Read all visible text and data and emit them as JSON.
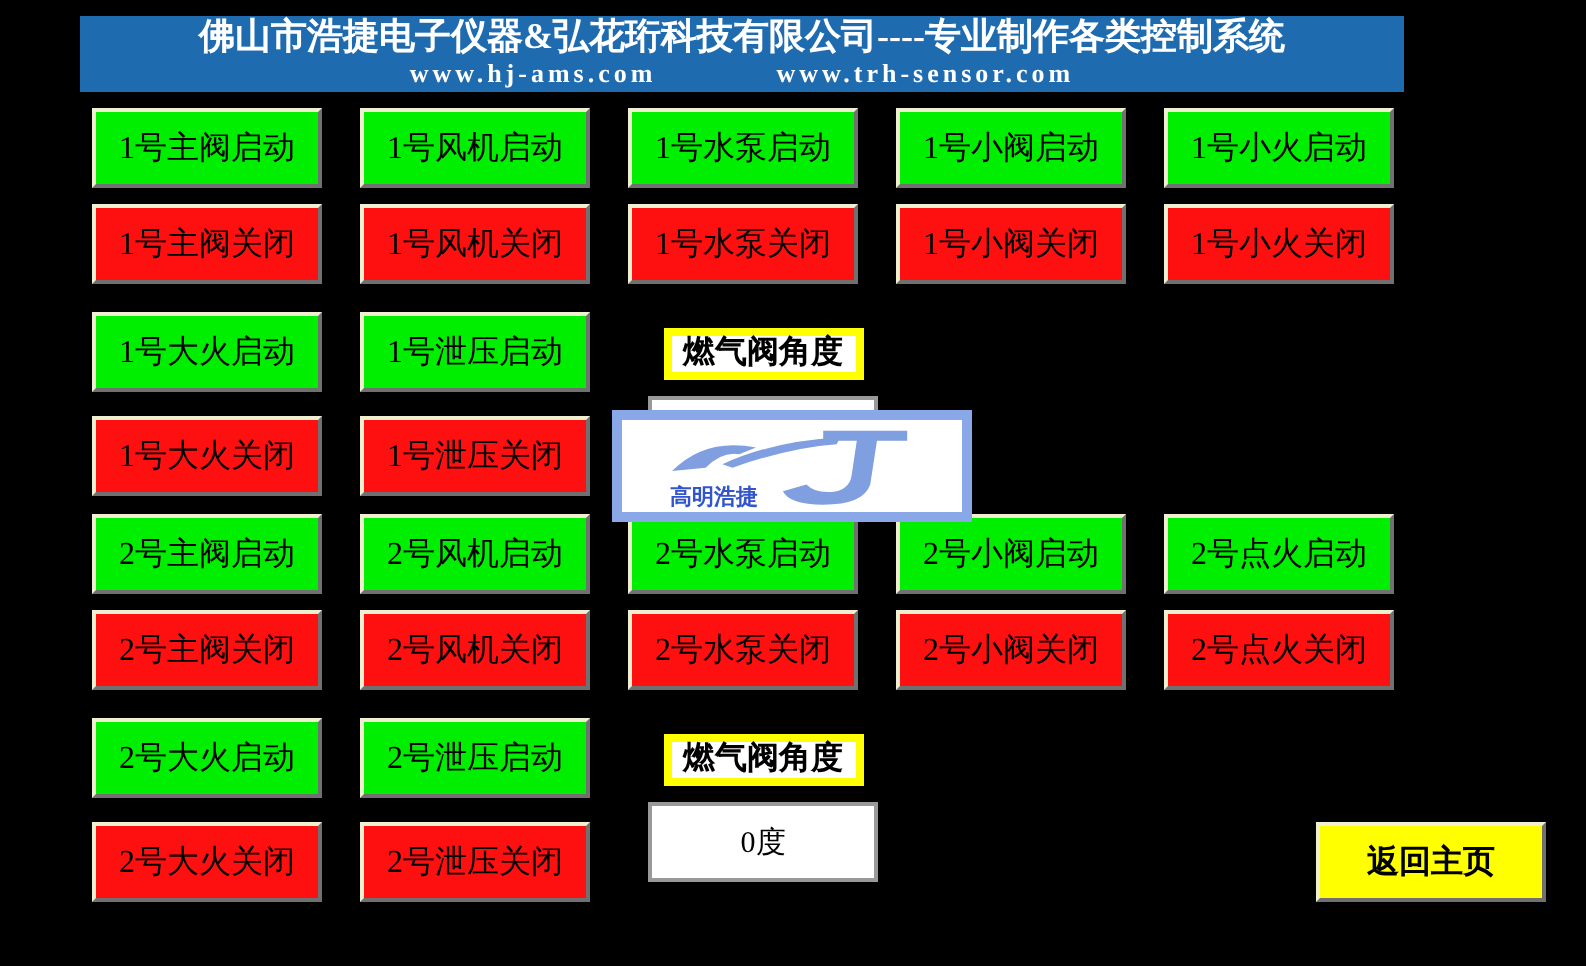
{
  "header": {
    "title": "佛山市浩捷电子仪器&弘花珩科技有限公司----专业制作各类控制系统",
    "websites": [
      "www.hj-ams.com",
      "www.trh-sensor.com"
    ]
  },
  "sections": [
    {
      "start_buttons": [
        {
          "label": "1号主阀启动",
          "kind": "start"
        },
        {
          "label": "1号风机启动",
          "kind": "start"
        },
        {
          "label": "1号水泵启动",
          "kind": "start"
        },
        {
          "label": "1号小阀启动",
          "kind": "start"
        },
        {
          "label": "1号小火启动",
          "kind": "start"
        }
      ],
      "stop_buttons": [
        {
          "label": "1号主阀关闭",
          "kind": "stop"
        },
        {
          "label": "1号风机关闭",
          "kind": "stop"
        },
        {
          "label": "1号水泵关闭",
          "kind": "stop"
        },
        {
          "label": "1号小阀关闭",
          "kind": "stop"
        },
        {
          "label": "1号小火关闭",
          "kind": "stop"
        }
      ],
      "extra_columns": [
        [
          {
            "label": "1号大火启动",
            "kind": "start"
          },
          {
            "label": "1号大火关闭",
            "kind": "stop"
          }
        ],
        [
          {
            "label": "1号泄压启动",
            "kind": "start"
          },
          {
            "label": "1号泄压关闭",
            "kind": "stop"
          }
        ]
      ],
      "gauge": {
        "label": "燃气阀角度"
      }
    },
    {
      "start_buttons": [
        {
          "label": "2号主阀启动",
          "kind": "start"
        },
        {
          "label": "2号风机启动",
          "kind": "start"
        },
        {
          "label": "2号水泵启动",
          "kind": "start"
        },
        {
          "label": "2号小阀启动",
          "kind": "start"
        },
        {
          "label": "2号点火启动",
          "kind": "start"
        }
      ],
      "stop_buttons": [
        {
          "label": "2号主阀关闭",
          "kind": "stop"
        },
        {
          "label": "2号风机关闭",
          "kind": "stop"
        },
        {
          "label": "2号水泵关闭",
          "kind": "stop"
        },
        {
          "label": "2号小阀关闭",
          "kind": "stop"
        },
        {
          "label": "2号点火关闭",
          "kind": "stop"
        }
      ],
      "extra_columns": [
        [
          {
            "label": "2号大火启动",
            "kind": "start"
          },
          {
            "label": "2号大火关闭",
            "kind": "stop"
          }
        ],
        [
          {
            "label": "2号泄压启动",
            "kind": "start"
          },
          {
            "label": "2号泄压关闭",
            "kind": "stop"
          }
        ]
      ],
      "gauge": {
        "label": "燃气阀角度",
        "value": "0度"
      },
      "nav_button": {
        "label": "返回主页",
        "kind": "nav"
      }
    }
  ],
  "logo": {
    "caption": "高明浩捷"
  }
}
